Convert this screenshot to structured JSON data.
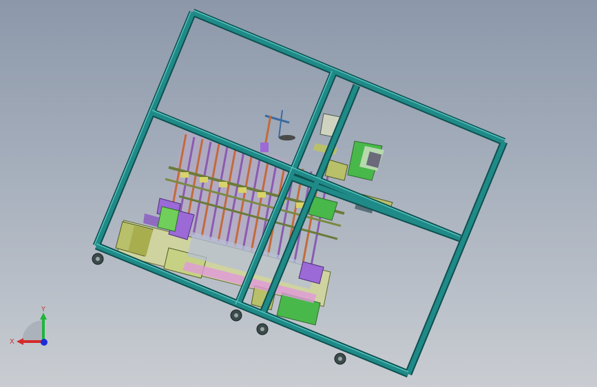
{
  "viewport": {
    "background_top": "#8c98aa",
    "background_bottom": "#c9cdd2"
  },
  "model": {
    "frame_color": "#1f8a87",
    "frame_edge_color": "#0d4f4e",
    "rod_color_a": "#c46a3a",
    "rod_color_b": "#8a5bb0",
    "panel_purple": "#9b6ad6",
    "panel_olive": "#b9c06a",
    "panel_green": "#49b84a",
    "bracket_yellow": "#d8d36a",
    "caster_color": "#3b4a4a"
  },
  "triad": {
    "x_label": "X",
    "y_label": "Y",
    "x_color": "#d42a2a",
    "y_color": "#1fb53a",
    "z_color": "#1a2fd6",
    "label_color": "#c73737"
  }
}
